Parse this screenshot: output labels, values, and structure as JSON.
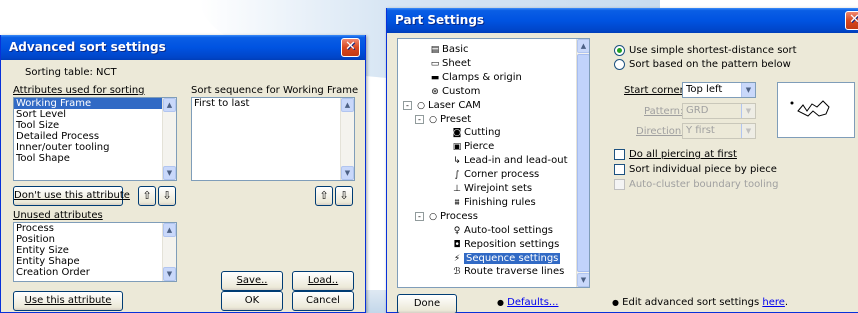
{
  "sort_dialog": {
    "title": "Advanced sort settings",
    "close_glyph": "✕",
    "sorting_table_label": "Sorting table: NCT",
    "used_attrs_label": "Attributes used for sorting",
    "used_attrs": [
      "Working Frame",
      "Sort Level",
      "Tool Size",
      "Detailed Process",
      "Inner/outer tooling",
      "Tool Shape"
    ],
    "selected_used_attr": "Working Frame",
    "sequence_label": "Sort sequence for Working Frame",
    "sequence_items": [
      "First to last"
    ],
    "dont_use_button": "Don't use this attribute",
    "up_arrow": "⇧",
    "down_arrow": "⇩",
    "unused_attrs_label": "Unused attributes",
    "unused_attrs": [
      "Process",
      "Position",
      "Entity Size",
      "Entity Shape",
      "Creation Order"
    ],
    "use_button": "Use this attribute",
    "save_button": "Save..",
    "load_button": "Load..",
    "ok_button": "OK",
    "cancel_button": "Cancel"
  },
  "part_settings": {
    "title": "Part Settings",
    "close_glyph": "✕",
    "tree": [
      {
        "label": "Basic",
        "icon": "basic-settings-icon",
        "glyph": "▤"
      },
      {
        "label": "Sheet",
        "icon": "sheet-icon",
        "glyph": "▭"
      },
      {
        "label": "Clamps & origin",
        "icon": "clamps-icon",
        "glyph": "▬"
      },
      {
        "label": "Custom",
        "icon": "custom-icon",
        "glyph": "⊛"
      },
      {
        "label": "Laser CAM",
        "icon": "laser-cam-node-icon",
        "glyph": "○"
      },
      {
        "label": "Preset",
        "icon": "preset-node-icon",
        "glyph": "○"
      },
      {
        "label": "Cutting",
        "icon": "cutting-icon",
        "glyph": "◙"
      },
      {
        "label": "Pierce",
        "icon": "pierce-icon",
        "glyph": "▣"
      },
      {
        "label": "Lead-in and lead-out",
        "icon": "lead-in-icon",
        "glyph": "↳"
      },
      {
        "label": "Corner process",
        "icon": "corner-process-icon",
        "glyph": "∫"
      },
      {
        "label": "Wirejoint sets",
        "icon": "wirejoint-icon",
        "glyph": "⊥"
      },
      {
        "label": "Finishing rules",
        "icon": "finishing-rules-icon",
        "glyph": "⩩"
      },
      {
        "label": "Process",
        "icon": "process-node-icon",
        "glyph": "○"
      },
      {
        "label": "Auto-tool settings",
        "icon": "auto-tool-icon",
        "glyph": "♀"
      },
      {
        "label": "Reposition settings",
        "icon": "reposition-icon",
        "glyph": "◘"
      },
      {
        "label": "Sequence settings",
        "icon": "sequence-icon",
        "glyph": "⚡"
      },
      {
        "label": "Route traverse lines",
        "icon": "route-traverse-icon",
        "glyph": "ℬ"
      }
    ],
    "selected_tree_item": "Sequence settings",
    "done_button": "Done",
    "defaults_link": "Defaults...",
    "bullet": "●",
    "radio_simple": "Use simple shortest-distance sort",
    "radio_pattern": "Sort based on the pattern below",
    "start_corner_label": "Start corner:",
    "start_corner_value": "Top left",
    "pattern_label": "Pattern:",
    "pattern_value": "GRD",
    "direction_label": "Direction:",
    "direction_value": "Y first",
    "chk_piercing": "Do all piercing at first",
    "chk_individual": "Sort individual piece by piece",
    "chk_autocluster": "Auto-cluster boundary tooling",
    "advanced_text": "Edit advanced sort settings",
    "advanced_link": "here",
    "period": "."
  }
}
